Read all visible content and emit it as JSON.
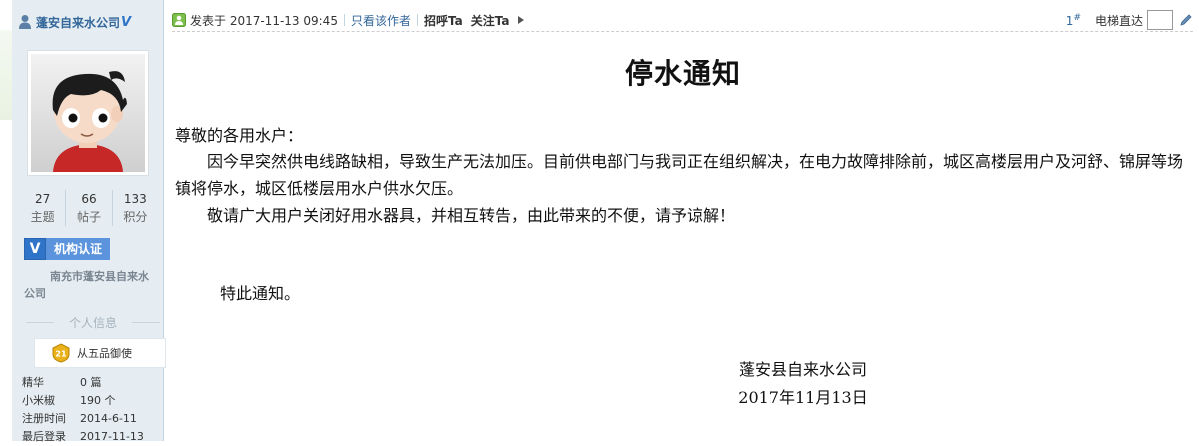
{
  "author": {
    "name": "蓬安自来水公司",
    "verified_mark": "V",
    "stats": [
      {
        "num": "27",
        "label": "主题"
      },
      {
        "num": "66",
        "label": "帖子"
      },
      {
        "num": "133",
        "label": "积分"
      }
    ],
    "verify_badge": "机构认证",
    "org": "南充市蓬安县自来水公司",
    "section_title": "个人信息",
    "medal": {
      "level": "21",
      "title": "从五品御使"
    },
    "info": [
      {
        "key": "精华",
        "value": "0 篇"
      },
      {
        "key": "小米椒",
        "value": "190 个"
      },
      {
        "key": "注册时间",
        "value": "2014-6-11"
      },
      {
        "key": "最后登录",
        "value": "2017-11-13"
      }
    ]
  },
  "post_header": {
    "posted_at": "发表于 2017-11-13 09:45",
    "only_author": "只看该作者",
    "greet": "招呼Ta",
    "follow": "关注Ta",
    "floor": "1",
    "floor_suffix": "#",
    "elevator_label": "电梯直达"
  },
  "article": {
    "title": "停水通知",
    "greeting": "尊敬的各用水户：",
    "paragraph1": "因今早突然供电线路缺相，导致生产无法加压。目前供电部门与我司正在组织解决，在电力故障排除前，城区高楼层用户及河舒、锦屏等场镇将停水，城区低楼层用水户供水欠压。",
    "paragraph2": "敬请广大用户关闭好用水器具，并相互转告，由此带来的不便，请予谅解！",
    "closing": "特此通知。",
    "signature": "蓬安县自来水公司",
    "date": "2017年11月13日"
  },
  "colors": {
    "sidebar_bg": "#e5edf2",
    "link": "#336699",
    "verify_blue": "#2f74c9"
  }
}
